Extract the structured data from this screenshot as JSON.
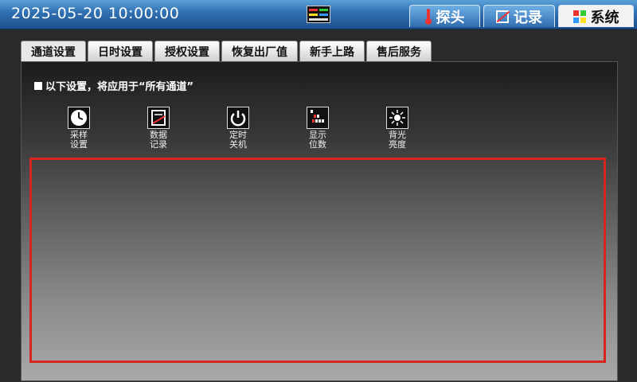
{
  "header": {
    "datetime": "2025-05-20  10:00:00",
    "tabs": [
      {
        "label": "探头",
        "icon": "thermometer-icon"
      },
      {
        "label": "记录",
        "icon": "record-pen-icon"
      },
      {
        "label": "系统",
        "icon": "system-grid-icon",
        "active": true
      }
    ]
  },
  "subtabs": [
    "通道设置",
    "日时设置",
    "授权设置",
    "恢复出厂值",
    "新手上路",
    "售后服务"
  ],
  "notice": "以下设置，将应用于“所有通道”",
  "tools": [
    {
      "line1": "采样",
      "line2": "设置",
      "icon": "clock-icon"
    },
    {
      "line1": "数据",
      "line2": "记录",
      "icon": "data-record-icon"
    },
    {
      "line1": "定时",
      "line2": "关机",
      "icon": "power-icon"
    },
    {
      "line1": "显示",
      "line2": "位数",
      "icon": "digits-icon"
    },
    {
      "line1": "背光",
      "line2": "亮度",
      "icon": "brightness-icon"
    }
  ],
  "colors": {
    "accent": "#2f6fb1",
    "highlight_border": "#d9231d"
  }
}
